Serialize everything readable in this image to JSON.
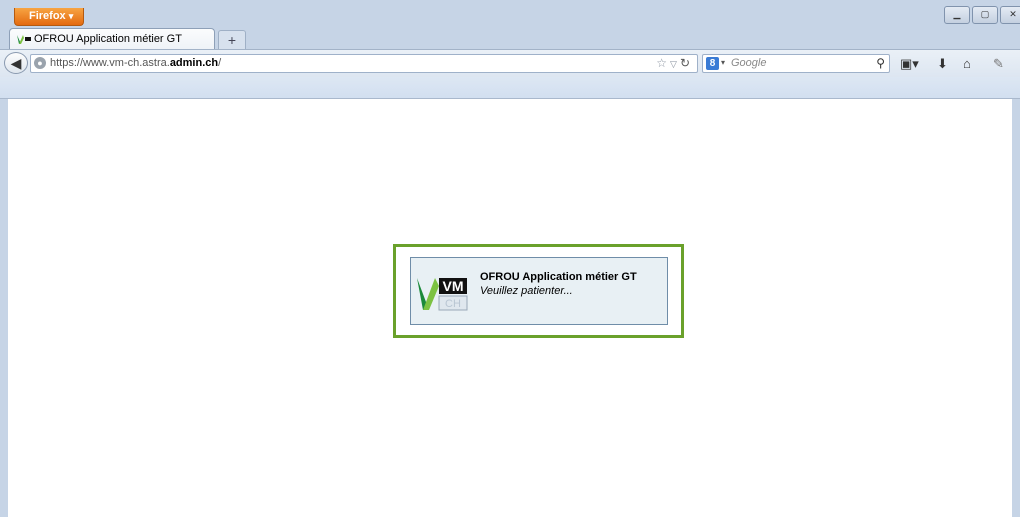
{
  "browser": {
    "menu_label": "Firefox",
    "menu_caret": "▾",
    "tab_title": "OFROU Application métier GT",
    "new_tab": "+",
    "url_prefix": "https://www.vm-ch.astra.",
    "url_domain": "admin.ch",
    "url_suffix": "/",
    "search_engine_letter": "8",
    "search_placeholder": "Google"
  },
  "page": {
    "loading_title": "OFROU Application métier GT",
    "loading_message": "Veuillez patienter...",
    "logo_text": "VM",
    "logo_sub": "CH"
  },
  "colors": {
    "accent_frame": "#6aa12b",
    "firefox_orange": "#e46a10",
    "box_bg": "#e8f0f4"
  }
}
